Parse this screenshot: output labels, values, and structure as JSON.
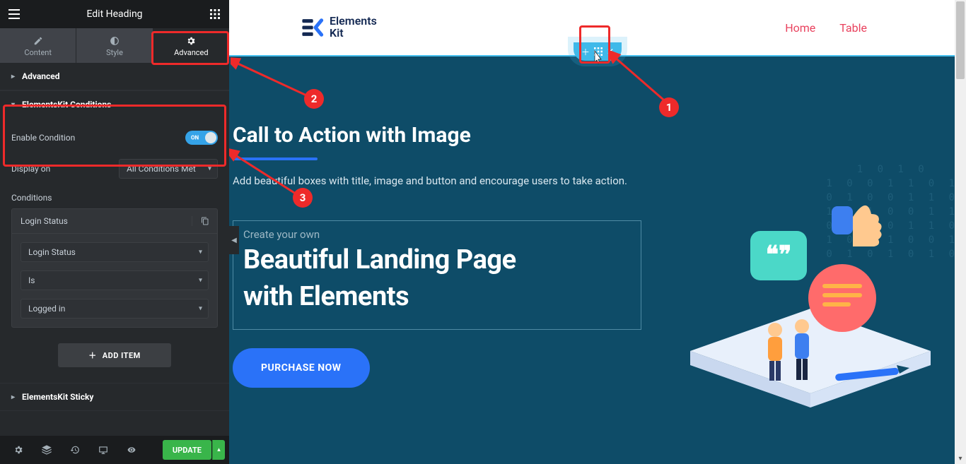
{
  "sidebar": {
    "title": "Edit Heading",
    "tabs": {
      "content": "Content",
      "style": "Style",
      "advanced": "Advanced"
    },
    "sections": {
      "advanced": {
        "label": "Advanced"
      },
      "conditions": {
        "label": "ElementsKit Conditions",
        "enable_label": "Enable Condition",
        "toggle_state": "ON",
        "display_on_label": "Display on",
        "display_on_value": "All Conditions Met",
        "conditions_label": "Conditions",
        "card_title": "Login Status",
        "field1_value": "Login Status",
        "field2_value": "Is",
        "field3_value": "Logged in",
        "add_item_label": "ADD ITEM"
      },
      "sticky": {
        "label": "ElementsKit Sticky"
      }
    },
    "footer": {
      "update_label": "UPDATE"
    }
  },
  "topnav": {
    "brand_line1": "Elements",
    "brand_line2": "Kit",
    "links": {
      "home": "Home",
      "table": "Table"
    }
  },
  "hero": {
    "title": "Call to Action with Image",
    "subtitle": "Add beautiful boxes with title, image and button and encourage users to take action.",
    "kicker": "Create your own",
    "heading_line1": "Beautiful Landing Page",
    "heading_line2": "with Elements",
    "cta_label": "PURCHASE NOW"
  },
  "annotations": {
    "badge1": "1",
    "badge2": "2",
    "badge3": "3"
  },
  "colors": {
    "accent_red": "#ee2a2a",
    "accent_blue": "#2a72f8",
    "hero_bg": "#0e4c68"
  }
}
